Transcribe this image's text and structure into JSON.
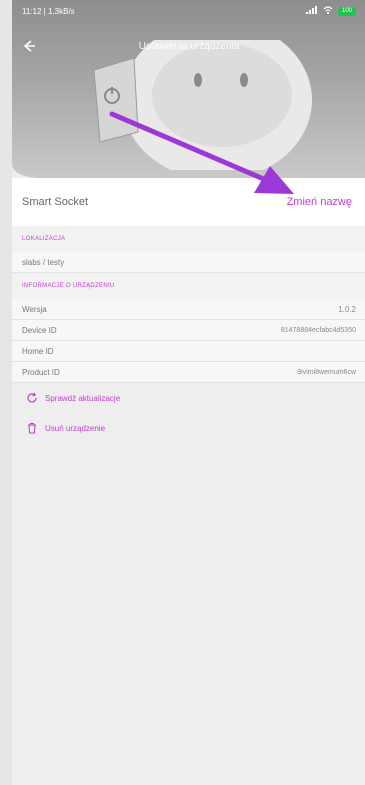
{
  "status_bar": {
    "time": "11:12 | 1,3kB/s",
    "battery": "100"
  },
  "header": {
    "title": "Ustawienia urządzenia"
  },
  "device": {
    "name": "Smart Socket",
    "rename_label": "Zmień nazwę"
  },
  "sections": {
    "location": {
      "header": "LOKALIZACJA",
      "value": "slabs / testy"
    },
    "info": {
      "header": "INFORMACJE O URZĄDZENIU",
      "rows": [
        {
          "label": "Wersja",
          "value": "1.0.2"
        },
        {
          "label": "Device ID",
          "value": "81478884ecfabc4d5350"
        },
        {
          "label": "Home ID",
          "value": ""
        },
        {
          "label": "Product ID",
          "value": "9ivimi8wemum6cw"
        }
      ]
    }
  },
  "actions": {
    "check_updates": "Sprawdź aktualizacje",
    "remove_device": "Usuń urządzenie"
  },
  "colors": {
    "accent": "#c23fd1",
    "arrow": "#9b38d6"
  },
  "icons": {
    "back": "arrow-left-icon",
    "refresh": "refresh-icon",
    "trash": "trash-icon",
    "battery": "battery-icon",
    "signal": "signal-icon",
    "wifi": "wifi-icon"
  }
}
